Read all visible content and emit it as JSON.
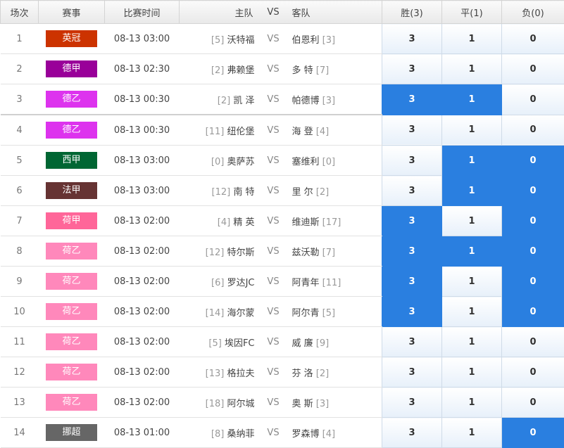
{
  "header": {
    "no": "场次",
    "league": "赛事",
    "time": "比赛时间",
    "home": "主队",
    "vs": "VS",
    "away": "客队",
    "win": "胜(3)",
    "draw": "平(1)",
    "lose": "负(0)"
  },
  "matches": [
    {
      "no": "1",
      "league": "英冠",
      "league_color": "#cc3300",
      "time": "08-13 03:00",
      "home_rank": "[5]",
      "home": "沃特福",
      "vs": "VS",
      "away": "伯恩利",
      "away_rank": "[3]",
      "win": "3",
      "draw": "1",
      "lose": "0",
      "win_sel": false,
      "draw_sel": false,
      "lose_sel": false
    },
    {
      "no": "2",
      "league": "德甲",
      "league_color": "#990099",
      "time": "08-13 02:30",
      "home_rank": "[2]",
      "home": "弗赖堡",
      "vs": "VS",
      "away": "多 特",
      "away_rank": "[7]",
      "win": "3",
      "draw": "1",
      "lose": "0",
      "win_sel": false,
      "draw_sel": false,
      "lose_sel": false
    },
    {
      "no": "3",
      "league": "德乙",
      "league_color": "#dd33ee",
      "time": "08-13 00:30",
      "home_rank": "[2]",
      "home": "凯 泽",
      "vs": "VS",
      "away": "帕德博",
      "away_rank": "[3]",
      "win": "3",
      "draw": "1",
      "lose": "0",
      "win_sel": true,
      "draw_sel": true,
      "lose_sel": false
    },
    {
      "no": "4",
      "league": "德乙",
      "league_color": "#dd33ee",
      "time": "08-13 00:30",
      "home_rank": "[11]",
      "home": "纽伦堡",
      "vs": "VS",
      "away": "海 登",
      "away_rank": "[4]",
      "win": "3",
      "draw": "1",
      "lose": "0",
      "win_sel": false,
      "draw_sel": false,
      "lose_sel": false
    },
    {
      "no": "5",
      "league": "西甲",
      "league_color": "#006633",
      "time": "08-13 03:00",
      "home_rank": "[0]",
      "home": "奥萨苏",
      "vs": "VS",
      "away": "塞维利",
      "away_rank": "[0]",
      "win": "3",
      "draw": "1",
      "lose": "0",
      "win_sel": false,
      "draw_sel": true,
      "lose_sel": true
    },
    {
      "no": "6",
      "league": "法甲",
      "league_color": "#663333",
      "time": "08-13 03:00",
      "home_rank": "[12]",
      "home": "南 特",
      "vs": "VS",
      "away": "里 尔",
      "away_rank": "[2]",
      "win": "3",
      "draw": "1",
      "lose": "0",
      "win_sel": false,
      "draw_sel": true,
      "lose_sel": true
    },
    {
      "no": "7",
      "league": "荷甲",
      "league_color": "#ff6699",
      "time": "08-13 02:00",
      "home_rank": "[4]",
      "home": "精 英",
      "vs": "VS",
      "away": "维迪斯",
      "away_rank": "[17]",
      "win": "3",
      "draw": "1",
      "lose": "0",
      "win_sel": true,
      "draw_sel": false,
      "lose_sel": true
    },
    {
      "no": "8",
      "league": "荷乙",
      "league_color": "#ff88bb",
      "time": "08-13 02:00",
      "home_rank": "[12]",
      "home": "特尔斯",
      "vs": "VS",
      "away": "兹沃勒",
      "away_rank": "[7]",
      "win": "3",
      "draw": "1",
      "lose": "0",
      "win_sel": true,
      "draw_sel": true,
      "lose_sel": true
    },
    {
      "no": "9",
      "league": "荷乙",
      "league_color": "#ff88bb",
      "time": "08-13 02:00",
      "home_rank": "[6]",
      "home": "罗达JC",
      "vs": "VS",
      "away": "阿青年",
      "away_rank": "[11]",
      "win": "3",
      "draw": "1",
      "lose": "0",
      "win_sel": true,
      "draw_sel": false,
      "lose_sel": true
    },
    {
      "no": "10",
      "league": "荷乙",
      "league_color": "#ff88bb",
      "time": "08-13 02:00",
      "home_rank": "[14]",
      "home": "海尔蒙",
      "vs": "VS",
      "away": "阿尔青",
      "away_rank": "[5]",
      "win": "3",
      "draw": "1",
      "lose": "0",
      "win_sel": true,
      "draw_sel": false,
      "lose_sel": true
    },
    {
      "no": "11",
      "league": "荷乙",
      "league_color": "#ff88bb",
      "time": "08-13 02:00",
      "home_rank": "[5]",
      "home": "埃因FC",
      "vs": "VS",
      "away": "威 廉",
      "away_rank": "[9]",
      "win": "3",
      "draw": "1",
      "lose": "0",
      "win_sel": false,
      "draw_sel": false,
      "lose_sel": false
    },
    {
      "no": "12",
      "league": "荷乙",
      "league_color": "#ff88bb",
      "time": "08-13 02:00",
      "home_rank": "[13]",
      "home": "格拉夫",
      "vs": "VS",
      "away": "芬 洛",
      "away_rank": "[2]",
      "win": "3",
      "draw": "1",
      "lose": "0",
      "win_sel": false,
      "draw_sel": false,
      "lose_sel": false
    },
    {
      "no": "13",
      "league": "荷乙",
      "league_color": "#ff88bb",
      "time": "08-13 02:00",
      "home_rank": "[18]",
      "home": "阿尔城",
      "vs": "VS",
      "away": "奥 斯",
      "away_rank": "[3]",
      "win": "3",
      "draw": "1",
      "lose": "0",
      "win_sel": false,
      "draw_sel": false,
      "lose_sel": false
    },
    {
      "no": "14",
      "league": "挪超",
      "league_color": "#666666",
      "time": "08-13 01:00",
      "home_rank": "[8]",
      "home": "桑纳菲",
      "vs": "VS",
      "away": "罗森博",
      "away_rank": "[4]",
      "win": "3",
      "draw": "1",
      "lose": "0",
      "win_sel": false,
      "draw_sel": false,
      "lose_sel": true
    }
  ],
  "colors": {
    "selected": "#2a7fe0",
    "header_bg": "#eeeeee"
  }
}
